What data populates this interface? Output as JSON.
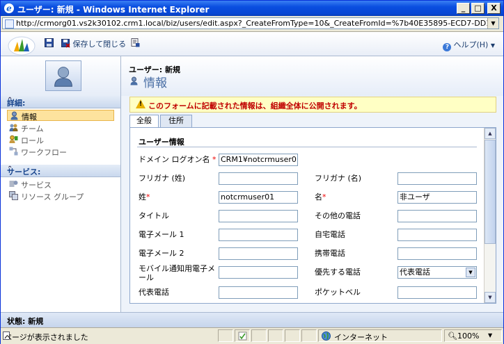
{
  "window": {
    "title": "ユーザー: 新規 - Windows Internet Explorer",
    "minimize": "_",
    "maximize": "□",
    "close": "X"
  },
  "address": {
    "url": "http://crmorg01.vs2k30102.crm1.local/biz/users/edit.aspx?_CreateFromType=10&_CreateFromId=%7b40E35895-ECD7-DD11-AC2C-"
  },
  "toolbar": {
    "save_close_label": "保存して閉じる",
    "help_label": "ヘルプ(H)"
  },
  "header": {
    "entity_title": "ユーザー: 新規",
    "form_title": "情報"
  },
  "nav": {
    "sections": [
      {
        "label": "詳細:",
        "items": [
          {
            "label": "情報",
            "icon": "user-icon",
            "selected": true
          },
          {
            "label": "チーム",
            "icon": "team-icon"
          },
          {
            "label": "ロール",
            "icon": "role-icon"
          },
          {
            "label": "ワークフロー",
            "icon": "workflow-icon"
          }
        ]
      },
      {
        "label": "サービス:",
        "items": [
          {
            "label": "サービス",
            "icon": "service-icon"
          },
          {
            "label": "リソース グループ",
            "icon": "resource-group-icon"
          }
        ]
      }
    ]
  },
  "notice": "このフォームに記載された情報は、組織全体に公開されます。",
  "tabs": [
    {
      "label": "全般",
      "active": true
    },
    {
      "label": "住所",
      "active": false
    }
  ],
  "form": {
    "section_title": "ユーザー情報",
    "fields": {
      "domain_logon": {
        "label": "ドメイン ログオン名",
        "required": "*",
        "value": "CRM1¥notcrmuser01"
      },
      "furigana_last": {
        "label": "フリガナ (姓)",
        "value": ""
      },
      "furigana_first": {
        "label": "フリガナ (名)",
        "value": ""
      },
      "last_name": {
        "label": "姓",
        "required": "*",
        "value": "notcrmuser01"
      },
      "first_name": {
        "label": "名",
        "required": "*",
        "value": "非ユーザ"
      },
      "title": {
        "label": "タイトル",
        "value": ""
      },
      "other_phone": {
        "label": "その他の電話",
        "value": ""
      },
      "email1": {
        "label": "電子メール 1",
        "value": ""
      },
      "home_phone": {
        "label": "自宅電話",
        "value": ""
      },
      "email2": {
        "label": "電子メール 2",
        "value": ""
      },
      "mobile_phone": {
        "label": "携帯電話",
        "value": ""
      },
      "mobile_alert_email": {
        "label": "モバイル通知用電子メール",
        "value": ""
      },
      "preferred_phone": {
        "label": "優先する電話",
        "value": "代表電話"
      },
      "main_phone": {
        "label": "代表電話",
        "value": ""
      },
      "pager": {
        "label": "ポケットベル",
        "value": ""
      }
    }
  },
  "state": "状態: 新規",
  "statusbar": {
    "message": "ページが表示されました",
    "zone": "インターネット",
    "zoom": "100%"
  }
}
